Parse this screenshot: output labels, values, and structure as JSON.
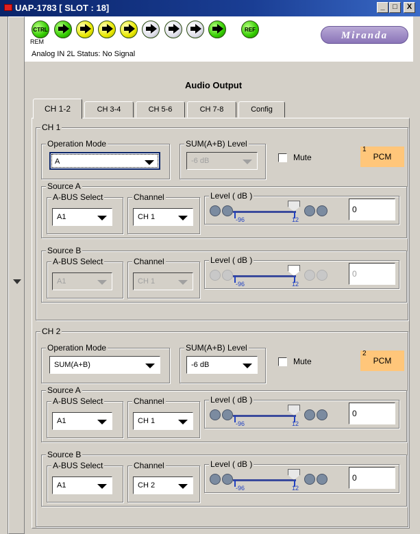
{
  "window": {
    "title": "UAP-1783 [ SLOT : 18]",
    "min": "_",
    "max": "□",
    "close": "X"
  },
  "header": {
    "leds": [
      {
        "label": "CTRL"
      },
      {
        "label": ""
      },
      {
        "label": ""
      },
      {
        "label": ""
      },
      {
        "label": ""
      },
      {
        "label": ""
      },
      {
        "label": ""
      },
      {
        "label": ""
      },
      {
        "label": ""
      },
      {
        "label": "REF"
      }
    ],
    "rem_label": "REM",
    "logo": "Miranda",
    "status": "Analog IN 2L Status: No Signal"
  },
  "section_title": "Audio Output",
  "tabs": [
    "CH 1-2",
    "CH 3-4",
    "CH 5-6",
    "CH 7-8",
    "Config"
  ],
  "ch1": {
    "group": "CH 1",
    "op_mode_label": "Operation Mode",
    "op_mode_value": "A",
    "sum_label": "SUM(A+B) Level",
    "sum_value": "-6 dB",
    "mute_label": "Mute",
    "pcm_num": "1",
    "pcm_label": "PCM",
    "srcA": {
      "group": "Source A",
      "bus_label": "A-BUS Select",
      "bus_value": "A1",
      "ch_label": "Channel",
      "ch_value": "CH 1",
      "level_label": "Level ( dB )",
      "min": "-96",
      "max": "12",
      "value": "0"
    },
    "srcB": {
      "group": "Source B",
      "bus_label": "A-BUS Select",
      "bus_value": "A1",
      "ch_label": "Channel",
      "ch_value": "CH 1",
      "level_label": "Level ( dB )",
      "min": "-96",
      "max": "12",
      "value": "0"
    }
  },
  "ch2": {
    "group": "CH 2",
    "op_mode_label": "Operation Mode",
    "op_mode_value": "SUM(A+B)",
    "sum_label": "SUM(A+B) Level",
    "sum_value": "-6 dB",
    "mute_label": "Mute",
    "pcm_num": "2",
    "pcm_label": "PCM",
    "srcA": {
      "group": "Source A",
      "bus_label": "A-BUS Select",
      "bus_value": "A1",
      "ch_label": "Channel",
      "ch_value": "CH 1",
      "level_label": "Level ( dB )",
      "min": "-96",
      "max": "12",
      "value": "0"
    },
    "srcB": {
      "group": "Source B",
      "bus_label": "A-BUS Select",
      "bus_value": "A1",
      "ch_label": "Channel",
      "ch_value": "CH 2",
      "level_label": "Level ( dB )",
      "min": "-96",
      "max": "12",
      "value": "0"
    }
  },
  "colors": {
    "titlebar": "#0a246a",
    "pcm": "#ffc67a",
    "led_green": "#33cc00",
    "led_yellow": "#e8e800",
    "led_white": "#e8e8f0"
  }
}
